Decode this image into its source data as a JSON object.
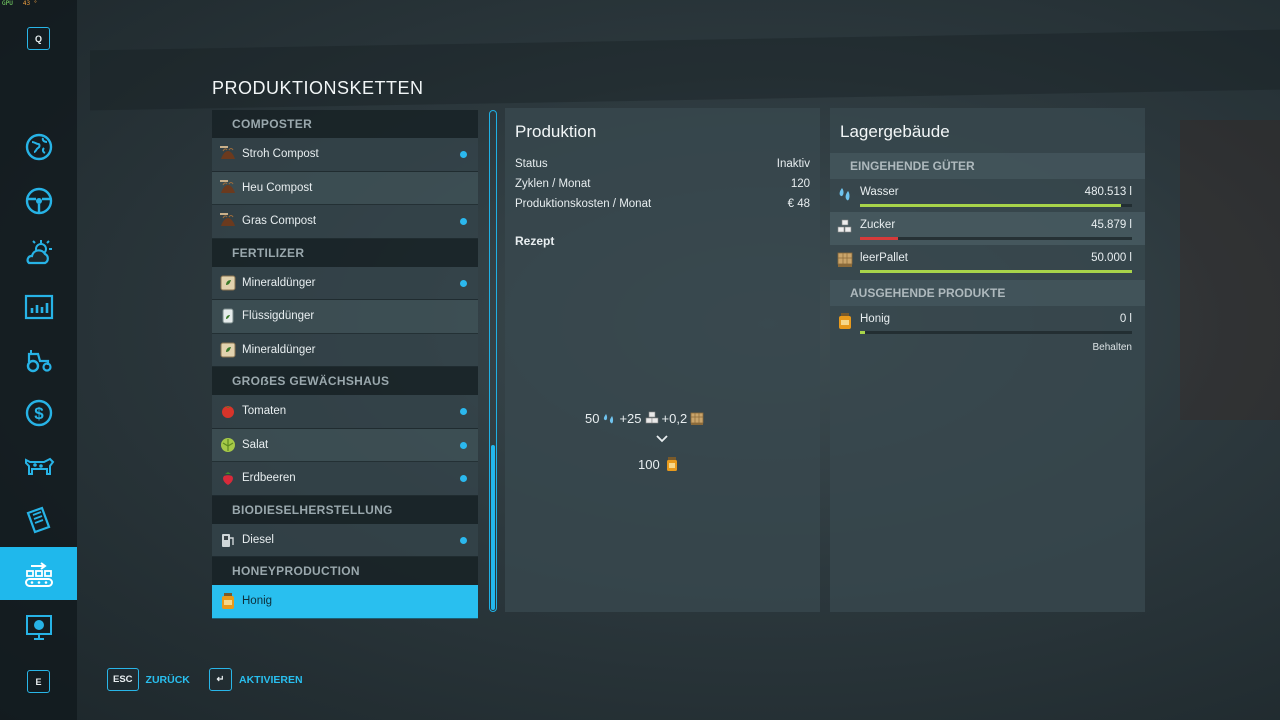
{
  "hud": {
    "gpu_label": "GPU",
    "gpu_value": "43 °"
  },
  "keys": {
    "top": "Q",
    "bottom": "E"
  },
  "title": "PRODUKTIONSKETTEN",
  "list": {
    "categories": [
      {
        "name": "COMPOSTER",
        "items": [
          {
            "label": "Stroh Compost",
            "icon": "compost-icon",
            "dot": true
          },
          {
            "label": "Heu Compost",
            "icon": "compost-icon",
            "dot": false
          },
          {
            "label": "Gras Compost",
            "icon": "compost-icon",
            "dot": true
          }
        ]
      },
      {
        "name": "FERTILIZER",
        "items": [
          {
            "label": "Mineraldünger",
            "icon": "fertilizer-bag-icon",
            "dot": true
          },
          {
            "label": "Flüssigdünger",
            "icon": "liquid-fertilizer-icon",
            "dot": false
          },
          {
            "label": "Mineraldünger",
            "icon": "fertilizer-bag-icon",
            "dot": false
          }
        ]
      },
      {
        "name": "GROẞES GEWÄCHSHAUS",
        "items": [
          {
            "label": "Tomaten",
            "icon": "tomato-icon",
            "dot": true
          },
          {
            "label": "Salat",
            "icon": "lettuce-icon",
            "dot": true
          },
          {
            "label": "Erdbeeren",
            "icon": "strawberry-icon",
            "dot": true
          }
        ]
      },
      {
        "name": "BIODIESELHERSTELLUNG",
        "items": [
          {
            "label": "Diesel",
            "icon": "diesel-icon",
            "dot": true
          }
        ]
      },
      {
        "name": "HONEYPRODUCTION",
        "items": [
          {
            "label": "Honig",
            "icon": "honey-jar-icon",
            "dot": false,
            "selected": true
          }
        ]
      }
    ]
  },
  "production": {
    "title": "Produktion",
    "status_label": "Status",
    "status_value": "Inaktiv",
    "cycles_label": "Zyklen / Monat",
    "cycles_value": "120",
    "cost_label": "Produktionskosten / Monat",
    "cost_value": "€ 48",
    "recipe_label": "Rezept",
    "recipe_in_1": "50",
    "recipe_in_2": "+25",
    "recipe_in_3": "+0,2",
    "recipe_out": "100"
  },
  "storage": {
    "title": "Lagergebäude",
    "incoming_header": "EINGEHENDE GÜTER",
    "outgoing_header": "AUSGEHENDE PRODUKTE",
    "incoming": [
      {
        "name": "Wasser",
        "value": "480.513 l",
        "fill": 0.96,
        "color": "#a8d44a"
      },
      {
        "name": "Zucker",
        "value": "45.879 l",
        "fill": 0.14,
        "color": "#d63a3a"
      },
      {
        "name": "leerPallet",
        "value": "50.000 l",
        "fill": 1.0,
        "color": "#a8d44a"
      }
    ],
    "outgoing": [
      {
        "name": "Honig",
        "value": "0 l",
        "fill": 0.02,
        "color": "#a8d44a",
        "mode": "Behalten"
      }
    ]
  },
  "footer": {
    "back_key": "ESC",
    "back_label": "ZURÜCK",
    "activate_key": "↵",
    "activate_label": "AKTIVIEREN"
  },
  "colors": {
    "accent": "#29bfef",
    "good": "#a8d44a",
    "bad": "#d63a3a"
  }
}
